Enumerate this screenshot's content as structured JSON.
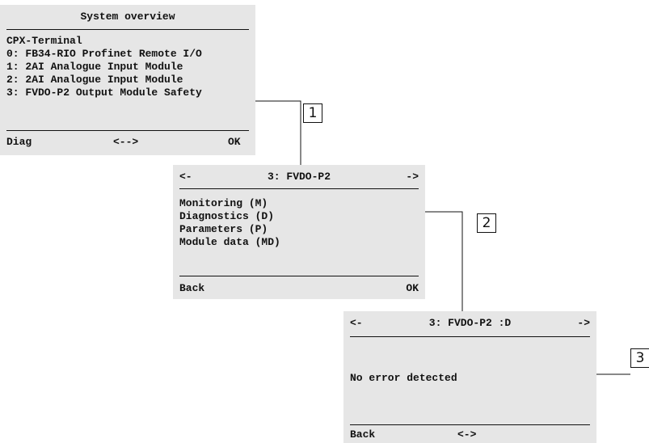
{
  "screen1": {
    "title": "System overview",
    "header": "CPX-Terminal",
    "items": [
      "0: FB34-RIO Profinet Remote I/O",
      "1: 2AI Analogue Input Module",
      "2: 2AI Analogue Input Module",
      "3: FVDO-P2 Output Module Safety"
    ],
    "footer": {
      "left": "Diag",
      "center": "<-->",
      "right": "OK"
    }
  },
  "screen2": {
    "nav_left": "<-",
    "title": "3: FVDO-P2",
    "nav_right": "->",
    "items": [
      "Monitoring (M)",
      "Diagnostics (D)",
      "Parameters (P)",
      "Module data (MD)"
    ],
    "footer": {
      "left": "Back",
      "right": "OK"
    }
  },
  "screen3": {
    "nav_left": "<-",
    "title": "3: FVDO-P2 :D",
    "nav_right": "->",
    "message": "No error detected",
    "footer": {
      "left": "Back",
      "center": "<->"
    }
  },
  "callouts": [
    "1",
    "2",
    "3"
  ]
}
